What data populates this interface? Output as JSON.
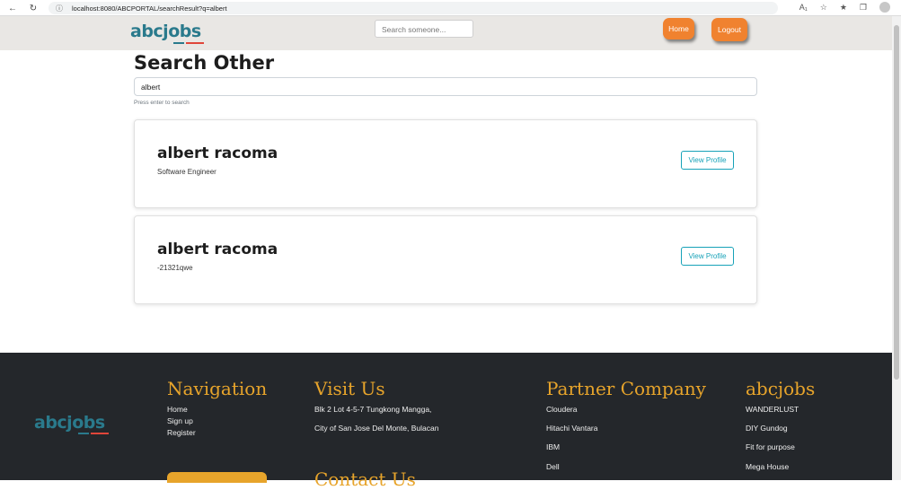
{
  "browser": {
    "url": "localhost:8080/ABCPORTAL/searchResult?q=albert"
  },
  "header": {
    "logo_text": "abcjobs",
    "search_placeholder": "Search someone...",
    "home_label": "Home",
    "logout_label": "Logout"
  },
  "main": {
    "title": "Search Other",
    "search_value": "albert",
    "hint": "Press enter to search",
    "results": [
      {
        "name": "albert racoma",
        "subtitle": "Software Engineer",
        "button": "View Profile"
      },
      {
        "name": "albert racoma",
        "subtitle": "-21321qwe",
        "button": "View Profile"
      }
    ]
  },
  "footer": {
    "logo_text": "abcjobs",
    "navigation": {
      "title": "Navigation",
      "items": [
        "Home",
        "Sign up",
        "Register"
      ]
    },
    "visit": {
      "title": "Visit Us",
      "lines": [
        "Blk 2 Lot 4-5-7 Tungkong Mangga,",
        "City of San Jose Del Monte, Bulacan"
      ]
    },
    "contact_title": "Contact Us",
    "partner": {
      "title": "Partner Company",
      "items": [
        "Cloudera",
        "Hitachi Vantara",
        "IBM",
        "Dell"
      ]
    },
    "abcjobs": {
      "title": "abcjobs",
      "items": [
        "WANDERLUST",
        "DIY Gundog",
        "Fit for purpose",
        "Mega House"
      ]
    }
  },
  "colors": {
    "accent_orange": "#f0822f",
    "footer_bg": "#24272b",
    "footer_heading": "#e7a42b",
    "logo_blue": "#2a7a8c",
    "button_teal": "#17a2b8"
  },
  "icons": [
    "back-arrow-icon",
    "reload-icon",
    "info-icon",
    "read-aloud-icon",
    "favorite-icon",
    "favorites-icon",
    "collections-icon",
    "profile-avatar-icon"
  ]
}
